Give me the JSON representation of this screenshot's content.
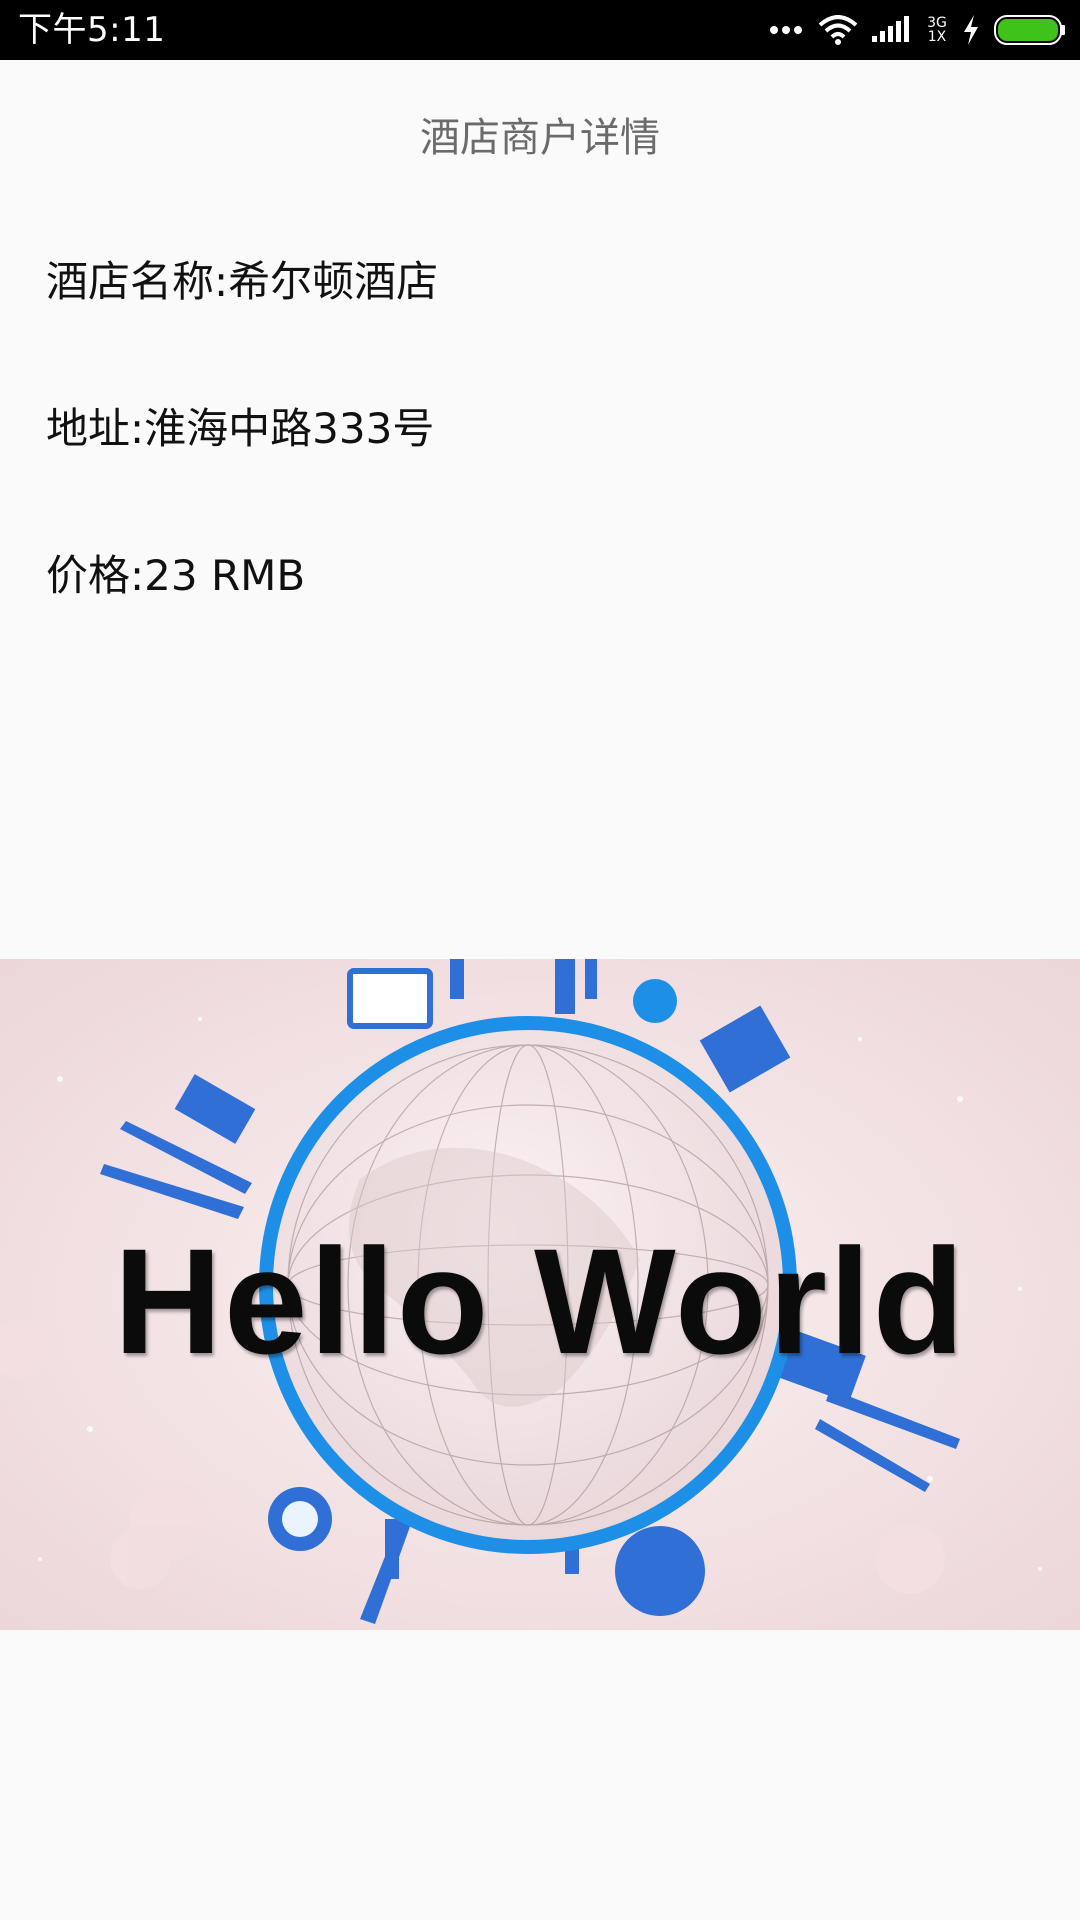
{
  "status_bar": {
    "time": "下午5:11",
    "network_label_top": "3G",
    "network_label_bottom": "1X",
    "icons": [
      "more-dots-icon",
      "wifi-icon",
      "signal-icon",
      "charging-icon",
      "battery-icon"
    ],
    "battery_color": "#3fc21a"
  },
  "header": {
    "title": "酒店商户详情"
  },
  "hotel": {
    "name_line": "酒店名称:希尔顿酒店",
    "address_line": "地址:淮海中路333号",
    "price_line": "价格:23 RMB"
  },
  "banner": {
    "text": "Hello World",
    "accent_color": "#1e8fe6"
  }
}
